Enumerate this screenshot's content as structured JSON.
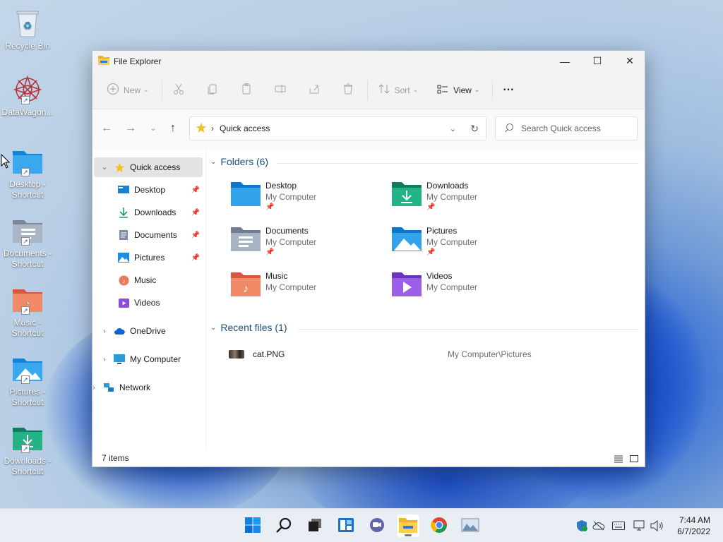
{
  "desktop": {
    "icons": [
      {
        "label": "Recycle Bin",
        "icon": "recycle-bin-icon"
      },
      {
        "label": "DataWagon...",
        "icon": "datawagon-icon"
      },
      {
        "label": "Desktop - Shortcut",
        "icon": "desktop-folder-icon"
      },
      {
        "label": "Documents - Shortcut",
        "icon": "documents-folder-icon"
      },
      {
        "label": "Music - Shortcut",
        "icon": "music-folder-icon"
      },
      {
        "label": "Pictures - Shortcut",
        "icon": "pictures-folder-icon"
      },
      {
        "label": "Downloads - Shortcut",
        "icon": "downloads-folder-icon"
      }
    ]
  },
  "window": {
    "title": "File Explorer",
    "controls": {
      "minimize": "—",
      "maximize": "☐",
      "close": "✕"
    }
  },
  "toolbar": {
    "new_label": "New",
    "sort_label": "Sort",
    "view_label": "View",
    "more_label": "···"
  },
  "nav": {
    "address_text": "Quick access",
    "search_placeholder": "Search Quick access"
  },
  "sidebar": {
    "quick_access": "Quick access",
    "pinned": [
      {
        "label": "Desktop",
        "pinned": true
      },
      {
        "label": "Downloads",
        "pinned": true
      },
      {
        "label": "Documents",
        "pinned": true
      },
      {
        "label": "Pictures",
        "pinned": true
      },
      {
        "label": "Music",
        "pinned": false
      },
      {
        "label": "Videos",
        "pinned": false
      }
    ],
    "onedrive": "OneDrive",
    "my_computer": "My Computer",
    "network": "Network"
  },
  "content": {
    "folders_header": "Folders (6)",
    "folders": [
      {
        "name": "Desktop",
        "location": "My Computer",
        "pinned": true
      },
      {
        "name": "Downloads",
        "location": "My Computer",
        "pinned": true
      },
      {
        "name": "Documents",
        "location": "My Computer",
        "pinned": true
      },
      {
        "name": "Pictures",
        "location": "My Computer",
        "pinned": true
      },
      {
        "name": "Music",
        "location": "My Computer",
        "pinned": false
      },
      {
        "name": "Videos",
        "location": "My Computer",
        "pinned": false
      }
    ],
    "recent_header": "Recent files (1)",
    "recent": [
      {
        "name": "cat.PNG",
        "path": "My Computer\\Pictures"
      }
    ]
  },
  "status": {
    "items": "7 items"
  },
  "taskbar": {
    "time": "7:44 AM",
    "date": "6/7/2022"
  },
  "colors": {
    "accent": "#0067c0",
    "folder_blue": "#1e9be8",
    "folder_green": "#1c9b73",
    "folder_gray": "#7d8ea3",
    "folder_orange": "#e8795a",
    "folder_purple": "#8a4fd6"
  }
}
